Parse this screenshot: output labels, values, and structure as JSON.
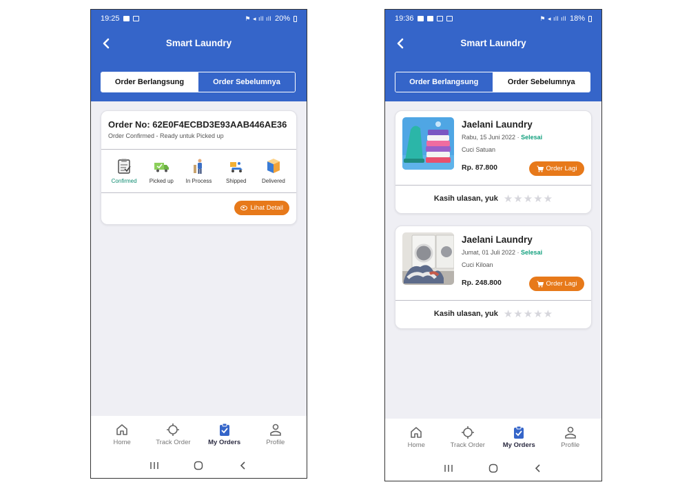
{
  "colors": {
    "primary": "#3565c9",
    "accent": "#e7791a",
    "success": "#0b8a6f",
    "background": "#efeff4"
  },
  "left": {
    "status": {
      "time": "19:25",
      "battery": "20%"
    },
    "app_title": "Smart Laundry",
    "tabs": [
      {
        "label": "Order Berlangsung",
        "active": true
      },
      {
        "label": "Order Sebelumnya",
        "active": false
      }
    ],
    "order": {
      "title": "Order No: 62E0F4ECBD3E93AAB446AE36",
      "status_text": "Order Confirmed - Ready untuk Picked up",
      "steps": [
        {
          "label": "Confirmed",
          "icon": "clipboard-check-icon",
          "active": true
        },
        {
          "label": "Picked up",
          "icon": "delivery-truck-icon",
          "active": false
        },
        {
          "label": "In Process",
          "icon": "worker-icon",
          "active": false
        },
        {
          "label": "Shipped",
          "icon": "shipping-scooter-icon",
          "active": false
        },
        {
          "label": "Delivered",
          "icon": "package-icon",
          "active": false
        }
      ],
      "detail_button": "Lihat Detail"
    },
    "nav": [
      {
        "label": "Home",
        "icon": "home-icon",
        "active": false
      },
      {
        "label": "Track Order",
        "icon": "crosshair-icon",
        "active": false
      },
      {
        "label": "My Orders",
        "icon": "orders-clipboard-icon",
        "active": true
      },
      {
        "label": "Profile",
        "icon": "person-icon",
        "active": false
      }
    ]
  },
  "right": {
    "status": {
      "time": "19:36",
      "battery": "18%"
    },
    "app_title": "Smart Laundry",
    "tabs": [
      {
        "label": "Order Berlangsung",
        "active": false
      },
      {
        "label": "Order Sebelumnya",
        "active": true
      }
    ],
    "history": [
      {
        "name": "Jaelani Laundry",
        "date": "Rabu, 15 Juni 2022",
        "status": "Selesai",
        "service": "Cuci Satuan",
        "price": "Rp. 87.800",
        "reorder_button": "Order Lagi",
        "review_text": "Kasih ulasan, yuk",
        "rating": 0,
        "image": "iron-and-clothes-stack"
      },
      {
        "name": "Jaelani Laundry",
        "date": "Jumat, 01 Juli 2022",
        "status": "Selesai",
        "service": "Cuci Kiloan",
        "price": "Rp. 248.800",
        "reorder_button": "Order Lagi",
        "review_text": "Kasih ulasan, yuk",
        "rating": 0,
        "image": "washing-machine-laundry-pile"
      }
    ],
    "nav": [
      {
        "label": "Home",
        "icon": "home-icon",
        "active": false
      },
      {
        "label": "Track Order",
        "icon": "crosshair-icon",
        "active": false
      },
      {
        "label": "My Orders",
        "icon": "orders-clipboard-icon",
        "active": true
      },
      {
        "label": "Profile",
        "icon": "person-icon",
        "active": false
      }
    ]
  }
}
